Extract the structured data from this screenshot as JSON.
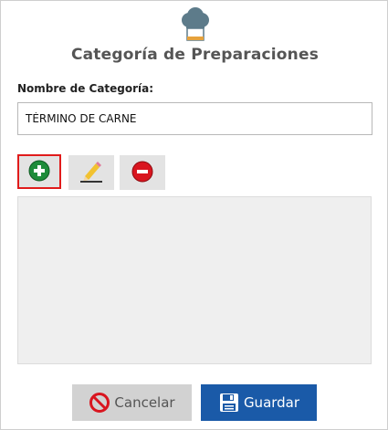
{
  "dialog": {
    "header_icon": "chef-hat-icon",
    "title": "Categoría de Preparaciones"
  },
  "form": {
    "name_label": "Nombre de Categoría:",
    "name_value": "TÉRMINO DE CARNE"
  },
  "toolbar": {
    "add_icon": "plus-circle-icon",
    "edit_icon": "pencil-icon",
    "delete_icon": "minus-circle-icon"
  },
  "list": {
    "items": []
  },
  "actions": {
    "cancel_label": "Cancelar",
    "cancel_icon": "no-entry-icon",
    "save_label": "Guardar",
    "save_icon": "floppy-disk-icon"
  },
  "colors": {
    "add_green": "#1e8c3a",
    "delete_red": "#d9151f",
    "save_blue": "#1a5aa8",
    "selection_border": "#e01b1b"
  }
}
